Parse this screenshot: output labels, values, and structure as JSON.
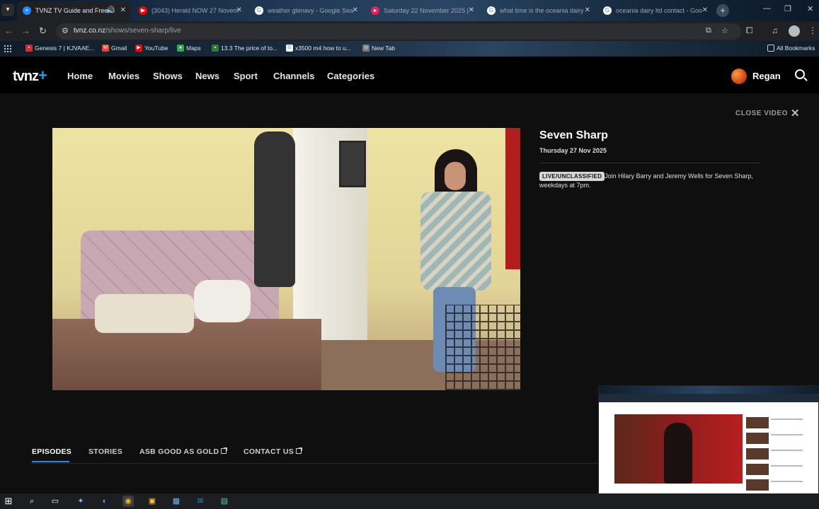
{
  "browser": {
    "tabs": [
      {
        "title": "TVNZ TV Guide and Free Li",
        "active": true,
        "icon": "tvnz-plus-icon"
      },
      {
        "title": "(3043) Herald NOW 27 Novem",
        "active": false,
        "icon": "youtube-icon"
      },
      {
        "title": "weather glenavy - Google Sea",
        "active": false,
        "icon": "google-icon"
      },
      {
        "title": "Saturday 22 November 2025 |",
        "active": false,
        "icon": "tvnz-icon"
      },
      {
        "title": "what time is the oceania dairy",
        "active": false,
        "icon": "google-icon"
      },
      {
        "title": "oceania dairy ltd contact - Goo",
        "active": false,
        "icon": "google-icon"
      }
    ],
    "url_host": "tvnz.co.nz",
    "url_path": "/shows/seven-sharp/live",
    "bookmarks": [
      {
        "label": "Genesis 7 | KJVAAE...",
        "color": "#d32f2f"
      },
      {
        "label": "Gmail",
        "color": "#ea4335"
      },
      {
        "label": "YouTube",
        "color": "#ff0000"
      },
      {
        "label": "Maps",
        "color": "#34a853"
      },
      {
        "label": "13.3 The price of to...",
        "color": "#2e7d32"
      },
      {
        "label": "x3500 m4 how to u...",
        "color": "#4285f4"
      },
      {
        "label": "New Tab",
        "color": "#777777"
      }
    ],
    "all_bookmarks_label": "All Bookmarks"
  },
  "tvnz": {
    "logo_text": "tvnz",
    "nav": [
      "Home",
      "Movies",
      "Shows",
      "News",
      "Sport",
      "Channels",
      "Categories"
    ],
    "user_name": "Regan",
    "close_video_label": "CLOSE VIDEO"
  },
  "show": {
    "title": "Seven Sharp",
    "date": "Thursday 27 Nov 2025",
    "rating": "LIVE/UNCLASSIFIED",
    "description": "Join Hilary Barry and Jeremy Wells for Seven Sharp, weekdays at 7pm."
  },
  "content_tabs": [
    {
      "label": "EPISODES",
      "active": true,
      "external": false
    },
    {
      "label": "STORIES",
      "active": false,
      "external": false
    },
    {
      "label": "ASB GOOD AS GOLD",
      "active": false,
      "external": true
    },
    {
      "label": "CONTACT US",
      "active": false,
      "external": true
    }
  ],
  "colors": {
    "accent": "#1a8cff",
    "header_bg": "#000000",
    "page_bg": "#0f0f10"
  }
}
